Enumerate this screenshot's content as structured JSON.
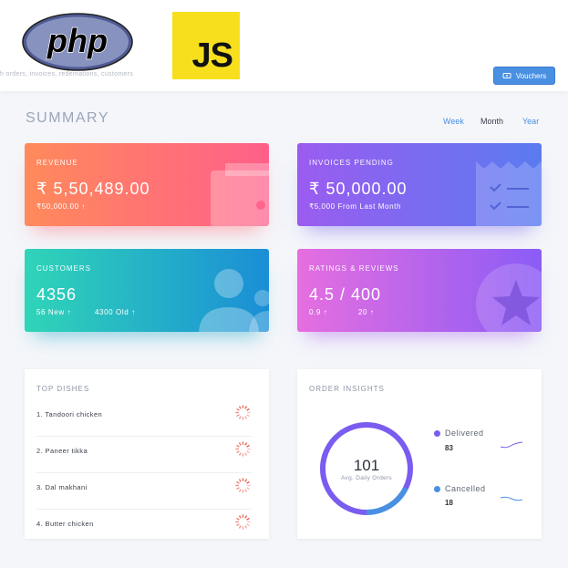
{
  "header": {
    "php_logo_text": "php",
    "js_logo_text": "JS",
    "subtitle": "h orders, invoices, redemations, customers",
    "vouchers_label": "Vouchers",
    "vouchers_icon": "voucher-icon"
  },
  "summary": {
    "title": "SUMMARY",
    "periods": [
      "Week",
      "Month",
      "Year"
    ],
    "selected_period": "Month"
  },
  "cards": {
    "revenue": {
      "label": "REVENUE",
      "value": "₹ 5,50,489.00",
      "sub": "₹50,000.00 ↑",
      "icon": "wallet-icon"
    },
    "invoices": {
      "label": "INVOICES PENDING",
      "value": "₹ 50,000.00",
      "sub": "₹5,000 From Last Month",
      "icon": "receipt-icon"
    },
    "customers": {
      "label": "CUSTOMERS",
      "value": "4356",
      "sub_new": "56 New ↑",
      "sub_old": "4300 Old ↑",
      "icon": "users-icon"
    },
    "ratings": {
      "label": "RATINGS & REVIEWS",
      "value": "4.5 / 400",
      "sub_a": "0.9 ↑",
      "sub_b": "20 ↑",
      "icon": "star-icon"
    }
  },
  "top_dishes": {
    "title": "TOP DISHES",
    "items": [
      "1. Tandoori chicken",
      "2. Paneer tikka",
      "3. Dal makhani",
      "4. Butter chicken"
    ]
  },
  "order_insights": {
    "title": "ORDER INSIGHTS",
    "value": "101",
    "value_label": "Avg. Daily Orders",
    "delivered": {
      "label": "Delivered",
      "value": "83",
      "color": "#7b5cf0"
    },
    "cancelled": {
      "label": "Cancelled",
      "value": "18",
      "color": "#4a90e2"
    }
  },
  "colors": {
    "accent": "#4a90e2",
    "ring_primary": "#7b5cf0",
    "ring_secondary": "#4a90e2",
    "spinner": "#e74c3c"
  }
}
